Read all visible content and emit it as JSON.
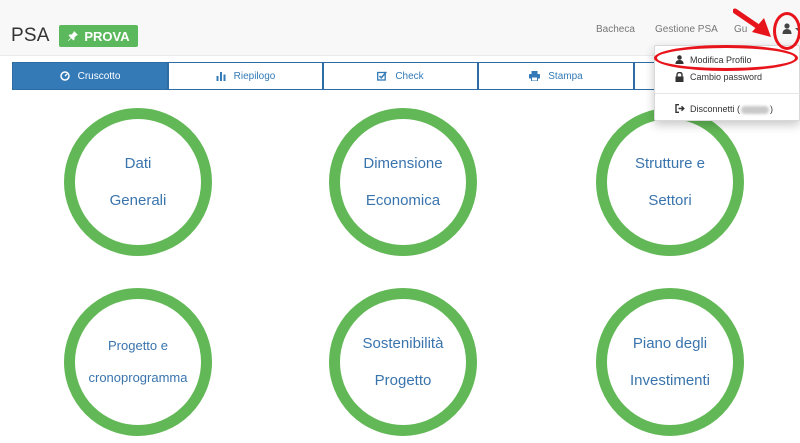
{
  "navbar": {
    "brand": "PSA",
    "badge_label": "PROVA",
    "links": [
      "Bacheca",
      "Gestione PSA",
      "Gu"
    ]
  },
  "tabs": [
    {
      "label": "Cruscotto",
      "icon": "dashboard-icon",
      "active": true
    },
    {
      "label": "Riepilogo",
      "icon": "bar-chart-icon",
      "active": false
    },
    {
      "label": "Check",
      "icon": "check-square-icon",
      "active": false
    },
    {
      "label": "Stampa",
      "icon": "print-icon",
      "active": false
    },
    {
      "label": "",
      "icon": "",
      "active": false
    }
  ],
  "tiles": [
    {
      "line1": "Dati",
      "line2": "Generali"
    },
    {
      "line1": "Dimensione",
      "line2": "Economica"
    },
    {
      "line1": "Strutture e",
      "line2": "Settori"
    },
    {
      "line1": "Progetto e",
      "line2": "cronoprogramma"
    },
    {
      "line1": "Sostenibilità",
      "line2": "Progetto"
    },
    {
      "line1": "Piano degli",
      "line2": "Investimenti"
    }
  ],
  "user_menu": {
    "items": [
      {
        "label": "Modifica Profilo",
        "icon": "user-icon"
      },
      {
        "label": "Cambio password",
        "icon": "lock-icon"
      },
      {
        "label": "Disconnetti (",
        "suffix": ")",
        "icon": "sign-out-icon"
      }
    ]
  },
  "colors": {
    "navbar_bg": "#f8f8f8",
    "badge": "#5cb85c",
    "primary": "#337ab7",
    "tile_ring": "#62b856",
    "tile_text": "#3a74ad",
    "annotation": "#e8141c"
  }
}
